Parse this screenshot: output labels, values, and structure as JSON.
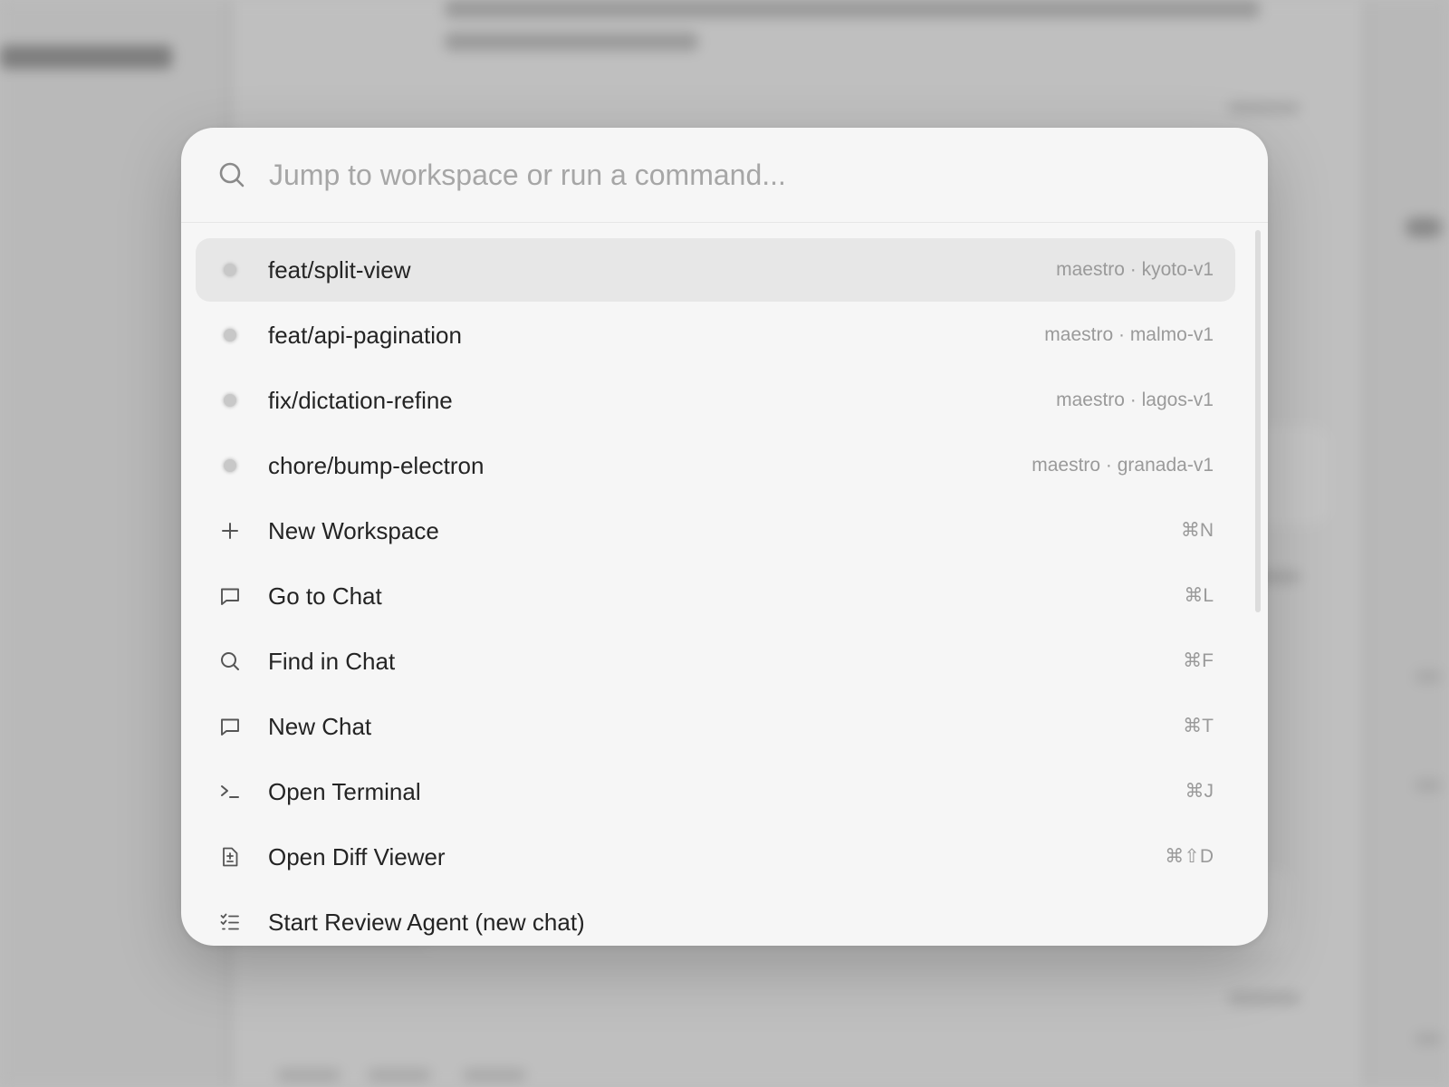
{
  "palette": {
    "search": {
      "placeholder": "Jump to workspace or run a command...",
      "value": ""
    },
    "workspaces": [
      {
        "branch": "feat/split-view",
        "meta": "maestro · kyoto-v1",
        "selected": true
      },
      {
        "branch": "feat/api-pagination",
        "meta": "maestro · malmo-v1",
        "selected": false
      },
      {
        "branch": "fix/dictation-refine",
        "meta": "maestro · lagos-v1",
        "selected": false
      },
      {
        "branch": "chore/bump-electron",
        "meta": "maestro · granada-v1",
        "selected": false
      }
    ],
    "commands": [
      {
        "label": "New Workspace",
        "shortcut": "⌘N",
        "icon": "plus-icon"
      },
      {
        "label": "Go to Chat",
        "shortcut": "⌘L",
        "icon": "chat-bubble-icon"
      },
      {
        "label": "Find in Chat",
        "shortcut": "⌘F",
        "icon": "search-icon"
      },
      {
        "label": "New Chat",
        "shortcut": "⌘T",
        "icon": "chat-bubble-icon"
      },
      {
        "label": "Open Terminal",
        "shortcut": "⌘J",
        "icon": "terminal-icon"
      },
      {
        "label": "Open Diff Viewer",
        "shortcut": "⌘⇧D",
        "icon": "diff-file-icon"
      },
      {
        "label": "Start Review Agent (new chat)",
        "shortcut": "",
        "icon": "checklist-icon"
      }
    ]
  },
  "colors": {
    "palette_bg": "#f6f6f6",
    "selected_bg": "#e7e7e7",
    "backdrop": "#bdbdbd",
    "text": "#242424",
    "muted": "#9a9a9a"
  }
}
